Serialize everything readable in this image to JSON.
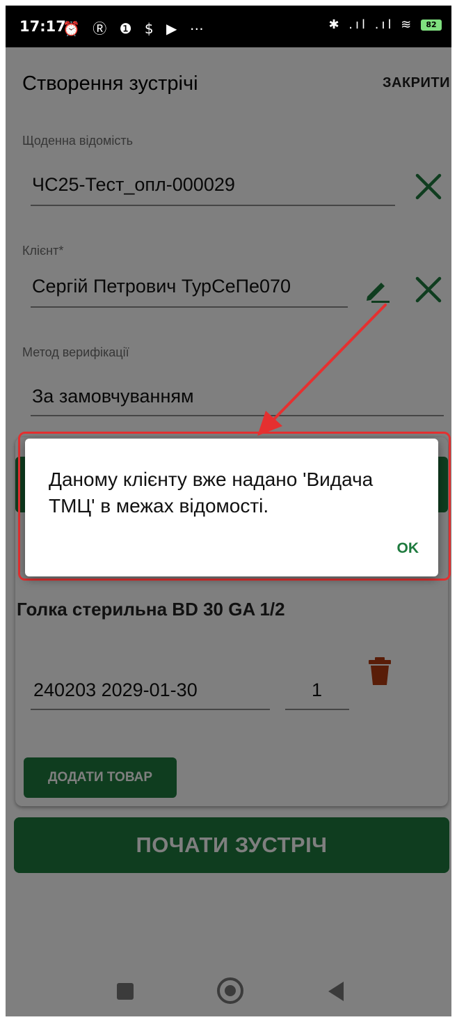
{
  "status_bar": {
    "time": "17:17",
    "left_icons": "⏰ Ⓡ ❶ $ ▶ ⋯",
    "right_icons": "✱ .ıl .ıl ≋",
    "battery": "82"
  },
  "header": {
    "title": "Створення зустрічі",
    "close_label": "ЗАКРИТИ"
  },
  "form": {
    "daily_statement": {
      "label": "Щоденна відомість",
      "value": "ЧС25-Тест_опл-000029"
    },
    "client": {
      "label": "Клієнт*",
      "value": "Сергій Петрович ТурСеПе070"
    },
    "verification_method": {
      "label": "Метод верифікації",
      "value": "За замовчуванням"
    }
  },
  "product": {
    "name": "Голка стерильна BD 30 GA 1/2",
    "lot": "240203 2029-01-30",
    "qty": "1",
    "add_label": "ДОДАТИ ТОВАР"
  },
  "start_button": "ПОЧАТИ ЗУСТРІЧ",
  "dialog": {
    "message": "Даному клієнту вже надано 'Видача ТМЦ' в межах відомості.",
    "ok_label": "OK"
  },
  "colors": {
    "accent": "#1e7a3e",
    "annotation": "#e53030"
  }
}
